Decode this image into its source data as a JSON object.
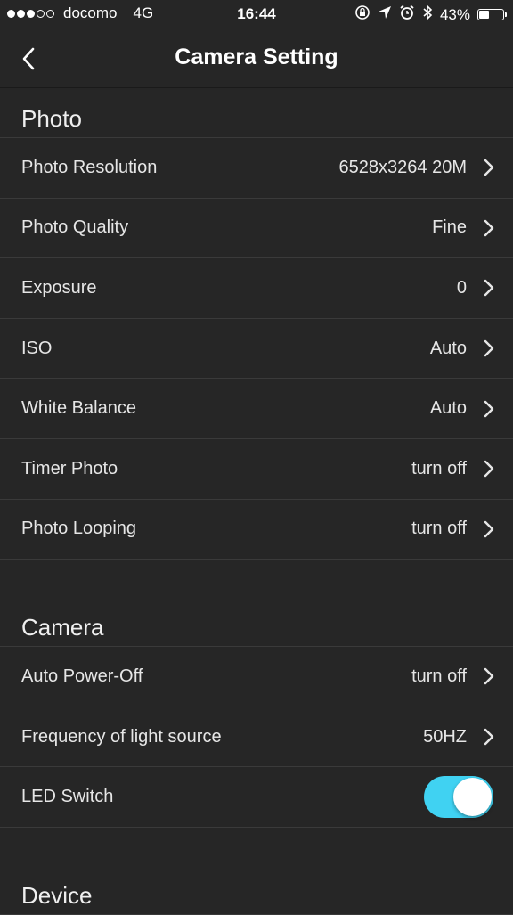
{
  "status_bar": {
    "carrier": "docomo",
    "network": "4G",
    "time": "16:44",
    "battery": "43%",
    "battery_level": 0.43,
    "signal_bars_full": 3,
    "signal_bars_total": 5,
    "icons": [
      "rotation-lock-icon",
      "location-icon",
      "alarm-icon",
      "bluetooth-icon",
      "battery-icon"
    ]
  },
  "nav": {
    "title": "Camera Setting",
    "back_icon": "chevron-left-icon"
  },
  "sections": {
    "photo": {
      "title": "Photo",
      "rows": [
        {
          "label": "Photo Resolution",
          "value": "6528x3264 20M"
        },
        {
          "label": "Photo Quality",
          "value": "Fine"
        },
        {
          "label": "Exposure",
          "value": "0"
        },
        {
          "label": "ISO",
          "value": "Auto"
        },
        {
          "label": "White Balance",
          "value": "Auto"
        },
        {
          "label": "Timer Photo",
          "value": "turn off"
        },
        {
          "label": "Photo Looping",
          "value": "turn off"
        }
      ]
    },
    "camera": {
      "title": "Camera",
      "rows": [
        {
          "label": "Auto Power-Off",
          "value": "turn off"
        },
        {
          "label": "Frequency of light source",
          "value": "50HZ"
        },
        {
          "label": "LED Switch",
          "toggle": true
        }
      ]
    },
    "device": {
      "title": "Device"
    }
  },
  "colors": {
    "background": "#262626",
    "toggle_on": "#40d2f2",
    "divider": "#3a3a3a",
    "text": "#e6e6e6"
  }
}
